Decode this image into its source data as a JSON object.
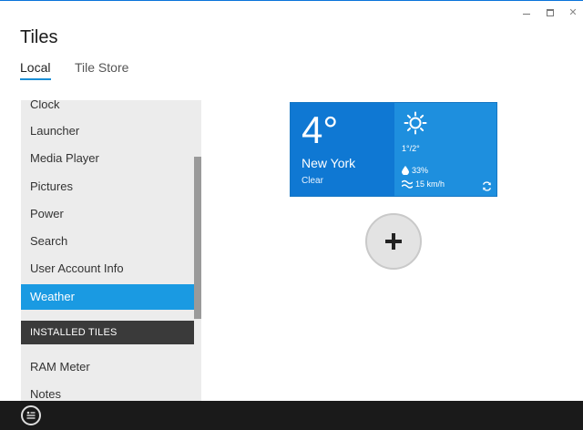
{
  "window": {
    "minimize_glyph": "",
    "maximize_glyph": "",
    "close_glyph": "✕"
  },
  "header": {
    "title": "Tiles"
  },
  "tabs": [
    {
      "label": "Local",
      "active": true
    },
    {
      "label": "Tile Store",
      "active": false
    }
  ],
  "sidebar": {
    "items": [
      {
        "label": "Clock"
      },
      {
        "label": "Launcher"
      },
      {
        "label": "Media Player"
      },
      {
        "label": "Pictures"
      },
      {
        "label": "Power"
      },
      {
        "label": "Search"
      },
      {
        "label": "User Account Info"
      },
      {
        "label": "Weather",
        "selected": true
      }
    ],
    "section_title": "INSTALLED TILES",
    "installed_items": [
      {
        "label": "RAM Meter"
      },
      {
        "label": "Notes"
      }
    ]
  },
  "weather_tile": {
    "temperature": "4°",
    "city": "New York",
    "condition": "Clear",
    "range": "1°/2°",
    "humidity": "33%",
    "wind": "15 km/h",
    "icons": [
      "sun-icon",
      "drop-icon",
      "wind-icon",
      "refresh-icon"
    ]
  },
  "add_button": {
    "icon": "plus-icon"
  },
  "bottom_bar": {
    "icon": "menu-icon"
  },
  "colors": {
    "accent": "#1a9ae2",
    "tile_dark": "#0f78d3",
    "tile_light": "#1e8fde",
    "bottom_bar": "#1a1a1a",
    "sidebar_bg": "#ececec"
  }
}
